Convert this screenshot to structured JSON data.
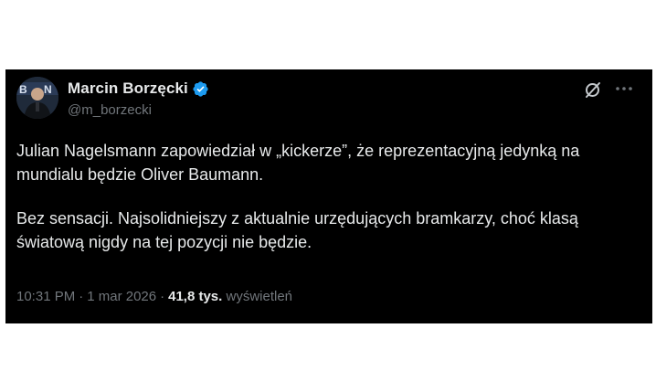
{
  "tweet": {
    "author": {
      "display_name": "Marcin Borzęcki",
      "handle": "@m_borzecki",
      "verified": true
    },
    "paragraphs": [
      "Julian Nagelsmann zapowiedział w „kickerze”, że reprezentacyjną jedynką na mundialu będzie Oliver Baumann.",
      "Bez sensacji. Najsolidniejszy z aktualnie urzędujących bramkarzy, choć klasą światową nigdy na tej pozycji nie będzie."
    ],
    "time": "10:31 PM",
    "date": "1 mar 2026",
    "separator": "·",
    "views_count": "41,8 tys.",
    "views_label": "wyświetleń"
  },
  "icons": {
    "verified": "verified-badge-icon",
    "grok": "grok-icon",
    "more": "more-options-icon"
  },
  "colors": {
    "background": "#000000",
    "text": "#e7e9ea",
    "secondary_text": "#71767b",
    "verified_blue": "#1d9bf0"
  }
}
